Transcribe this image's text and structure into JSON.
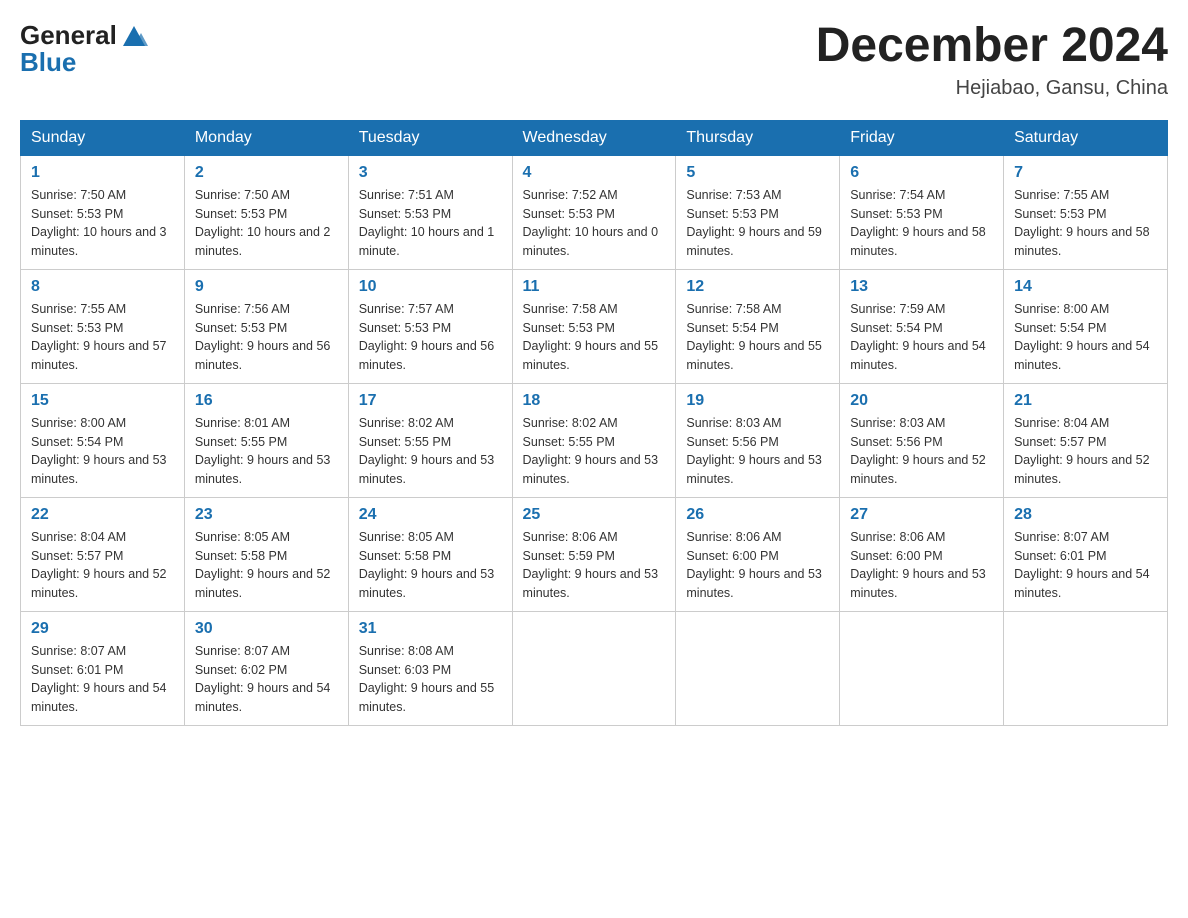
{
  "header": {
    "logo_line1": "General",
    "logo_line2": "Blue",
    "month_year": "December 2024",
    "location": "Hejiabao, Gansu, China"
  },
  "days_of_week": [
    "Sunday",
    "Monday",
    "Tuesday",
    "Wednesday",
    "Thursday",
    "Friday",
    "Saturday"
  ],
  "weeks": [
    [
      {
        "day": "1",
        "sunrise": "7:50 AM",
        "sunset": "5:53 PM",
        "daylight": "10 hours and 3 minutes."
      },
      {
        "day": "2",
        "sunrise": "7:50 AM",
        "sunset": "5:53 PM",
        "daylight": "10 hours and 2 minutes."
      },
      {
        "day": "3",
        "sunrise": "7:51 AM",
        "sunset": "5:53 PM",
        "daylight": "10 hours and 1 minute."
      },
      {
        "day": "4",
        "sunrise": "7:52 AM",
        "sunset": "5:53 PM",
        "daylight": "10 hours and 0 minutes."
      },
      {
        "day": "5",
        "sunrise": "7:53 AM",
        "sunset": "5:53 PM",
        "daylight": "9 hours and 59 minutes."
      },
      {
        "day": "6",
        "sunrise": "7:54 AM",
        "sunset": "5:53 PM",
        "daylight": "9 hours and 58 minutes."
      },
      {
        "day": "7",
        "sunrise": "7:55 AM",
        "sunset": "5:53 PM",
        "daylight": "9 hours and 58 minutes."
      }
    ],
    [
      {
        "day": "8",
        "sunrise": "7:55 AM",
        "sunset": "5:53 PM",
        "daylight": "9 hours and 57 minutes."
      },
      {
        "day": "9",
        "sunrise": "7:56 AM",
        "sunset": "5:53 PM",
        "daylight": "9 hours and 56 minutes."
      },
      {
        "day": "10",
        "sunrise": "7:57 AM",
        "sunset": "5:53 PM",
        "daylight": "9 hours and 56 minutes."
      },
      {
        "day": "11",
        "sunrise": "7:58 AM",
        "sunset": "5:53 PM",
        "daylight": "9 hours and 55 minutes."
      },
      {
        "day": "12",
        "sunrise": "7:58 AM",
        "sunset": "5:54 PM",
        "daylight": "9 hours and 55 minutes."
      },
      {
        "day": "13",
        "sunrise": "7:59 AM",
        "sunset": "5:54 PM",
        "daylight": "9 hours and 54 minutes."
      },
      {
        "day": "14",
        "sunrise": "8:00 AM",
        "sunset": "5:54 PM",
        "daylight": "9 hours and 54 minutes."
      }
    ],
    [
      {
        "day": "15",
        "sunrise": "8:00 AM",
        "sunset": "5:54 PM",
        "daylight": "9 hours and 53 minutes."
      },
      {
        "day": "16",
        "sunrise": "8:01 AM",
        "sunset": "5:55 PM",
        "daylight": "9 hours and 53 minutes."
      },
      {
        "day": "17",
        "sunrise": "8:02 AM",
        "sunset": "5:55 PM",
        "daylight": "9 hours and 53 minutes."
      },
      {
        "day": "18",
        "sunrise": "8:02 AM",
        "sunset": "5:55 PM",
        "daylight": "9 hours and 53 minutes."
      },
      {
        "day": "19",
        "sunrise": "8:03 AM",
        "sunset": "5:56 PM",
        "daylight": "9 hours and 53 minutes."
      },
      {
        "day": "20",
        "sunrise": "8:03 AM",
        "sunset": "5:56 PM",
        "daylight": "9 hours and 52 minutes."
      },
      {
        "day": "21",
        "sunrise": "8:04 AM",
        "sunset": "5:57 PM",
        "daylight": "9 hours and 52 minutes."
      }
    ],
    [
      {
        "day": "22",
        "sunrise": "8:04 AM",
        "sunset": "5:57 PM",
        "daylight": "9 hours and 52 minutes."
      },
      {
        "day": "23",
        "sunrise": "8:05 AM",
        "sunset": "5:58 PM",
        "daylight": "9 hours and 52 minutes."
      },
      {
        "day": "24",
        "sunrise": "8:05 AM",
        "sunset": "5:58 PM",
        "daylight": "9 hours and 53 minutes."
      },
      {
        "day": "25",
        "sunrise": "8:06 AM",
        "sunset": "5:59 PM",
        "daylight": "9 hours and 53 minutes."
      },
      {
        "day": "26",
        "sunrise": "8:06 AM",
        "sunset": "6:00 PM",
        "daylight": "9 hours and 53 minutes."
      },
      {
        "day": "27",
        "sunrise": "8:06 AM",
        "sunset": "6:00 PM",
        "daylight": "9 hours and 53 minutes."
      },
      {
        "day": "28",
        "sunrise": "8:07 AM",
        "sunset": "6:01 PM",
        "daylight": "9 hours and 54 minutes."
      }
    ],
    [
      {
        "day": "29",
        "sunrise": "8:07 AM",
        "sunset": "6:01 PM",
        "daylight": "9 hours and 54 minutes."
      },
      {
        "day": "30",
        "sunrise": "8:07 AM",
        "sunset": "6:02 PM",
        "daylight": "9 hours and 54 minutes."
      },
      {
        "day": "31",
        "sunrise": "8:08 AM",
        "sunset": "6:03 PM",
        "daylight": "9 hours and 55 minutes."
      },
      null,
      null,
      null,
      null
    ]
  ]
}
